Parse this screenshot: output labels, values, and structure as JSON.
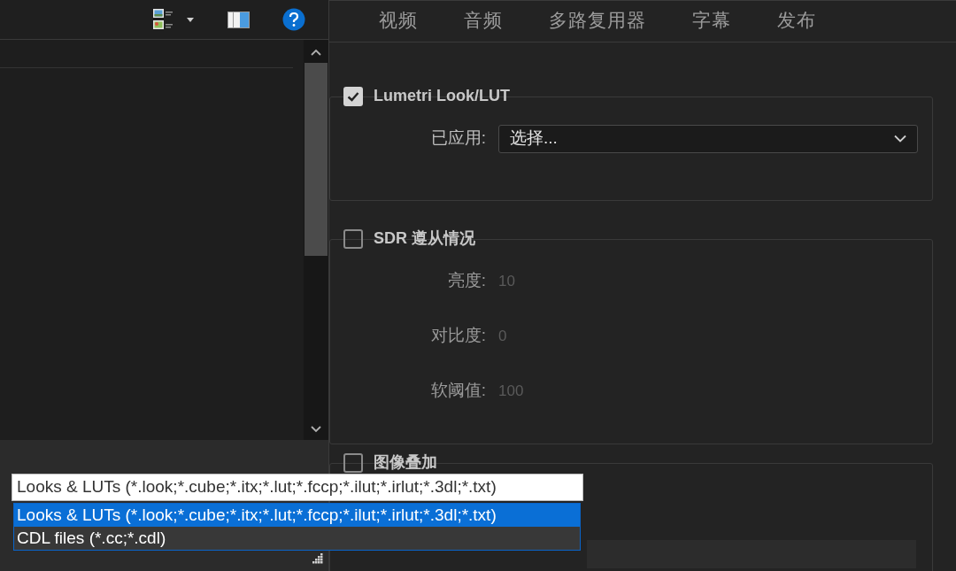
{
  "file_dialog": {
    "file_type": {
      "value": "Looks & LUTs (*.look;*.cube;*.itx;*.lut;*.fccp;*.ilut;*.irlut;*.3dl;*.txt)",
      "options": [
        {
          "label": "Looks & LUTs (*.look;*.cube;*.itx;*.lut;*.fccp;*.ilut;*.irlut;*.3dl;*.txt)",
          "selected": true
        },
        {
          "label": "CDL files (*.cc;*.cdl)",
          "selected": false
        }
      ]
    }
  },
  "export_settings": {
    "tabs": [
      {
        "label": "视频",
        "selected": false
      },
      {
        "label": "音频",
        "selected": false
      },
      {
        "label": "多路复用器",
        "selected": false
      },
      {
        "label": "字幕",
        "selected": false
      },
      {
        "label": "发布",
        "selected": false
      }
    ],
    "sections": [
      {
        "title": "Lumetri Look/LUT",
        "checked": true,
        "fields": [
          {
            "kind": "select",
            "label": "已应用:",
            "value": "选择..."
          }
        ]
      },
      {
        "title": "SDR 遵从情况",
        "checked": false,
        "fields": [
          {
            "kind": "number",
            "label": "亮度:",
            "value": "10"
          },
          {
            "kind": "number",
            "label": "对比度:",
            "value": "0"
          },
          {
            "kind": "number",
            "label": "软阈值:",
            "value": "100"
          }
        ]
      },
      {
        "title": "图像叠加",
        "checked": false,
        "fields": [
          {
            "kind": "input"
          }
        ]
      }
    ]
  }
}
